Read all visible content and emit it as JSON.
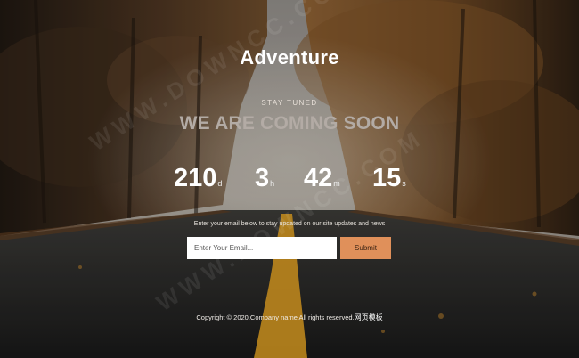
{
  "brand": {
    "title": "Adventure"
  },
  "hero": {
    "tagline": "STAY TUNED",
    "headline": "WE ARE COMING SOON"
  },
  "countdown": {
    "days": {
      "value": "210",
      "unit": "d"
    },
    "hours": {
      "value": "3",
      "unit": "h"
    },
    "minutes": {
      "value": "42",
      "unit": "m"
    },
    "seconds": {
      "value": "15",
      "unit": "s"
    }
  },
  "subscribe": {
    "note": "Enter your email below to stay updated on our site updates and news",
    "email_placeholder": "Enter Your Email...",
    "email_value": "",
    "submit_label": "Submit"
  },
  "footer": {
    "copyright": "Copyright © 2020.Company name All rights reserved.",
    "link_text": "网页模板"
  },
  "watermark": {
    "text": "WWW.DOWNCC.COM"
  },
  "colors": {
    "submit_button": "#e0905a",
    "headline_text": "#b3aba5",
    "road_line": "#e0a021"
  }
}
